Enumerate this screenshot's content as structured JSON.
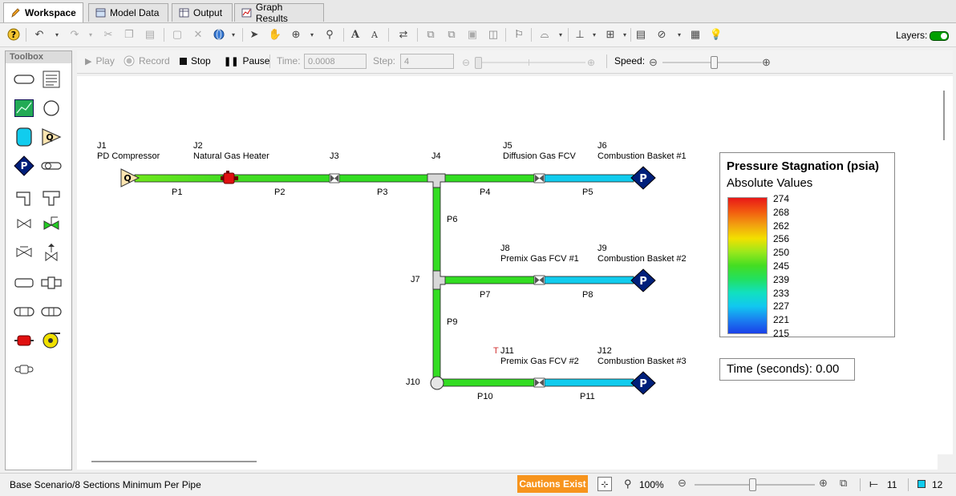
{
  "tabs": [
    {
      "label": "Workspace",
      "icon": "pencil-icon",
      "active": true
    },
    {
      "label": "Model Data",
      "icon": "model-data-icon",
      "active": false
    },
    {
      "label": "Output",
      "icon": "output-table-icon",
      "active": false
    },
    {
      "label": "Graph Results",
      "icon": "graph-icon",
      "active": false
    }
  ],
  "toolbar": {
    "layers_label": "Layers:"
  },
  "toolbox": {
    "title": "Toolbox"
  },
  "transient": {
    "play": "Play",
    "record": "Record",
    "stop": "Stop",
    "pause": "Pause",
    "time_label": "Time:",
    "time_value": "0.0008",
    "step_label": "Step:",
    "step_value": "4",
    "speed_label": "Speed:"
  },
  "junctions": {
    "J1": {
      "id": "J1",
      "name": "PD Compressor"
    },
    "J2": {
      "id": "J2",
      "name": "Natural Gas Heater"
    },
    "J3": {
      "id": "J3"
    },
    "J4": {
      "id": "J4"
    },
    "J5": {
      "id": "J5",
      "name": "Diffusion Gas FCV"
    },
    "J6": {
      "id": "J6",
      "name": "Combustion Basket #1"
    },
    "J7": {
      "id": "J7"
    },
    "J8": {
      "id": "J8",
      "name": "Premix Gas FCV #1"
    },
    "J9": {
      "id": "J9",
      "name": "Combustion Basket #2"
    },
    "J10": {
      "id": "J10"
    },
    "J11": {
      "id": "J11",
      "name": "Premix Gas FCV #2",
      "flag": "T"
    },
    "J12": {
      "id": "J12",
      "name": "Combustion Basket #3"
    }
  },
  "pipes": [
    "P1",
    "P2",
    "P3",
    "P4",
    "P5",
    "P6",
    "P7",
    "P8",
    "P9",
    "P10",
    "P11"
  ],
  "node_glyphs": {
    "compressor": "Q",
    "pressure": "P"
  },
  "legend": {
    "title": "Pressure Stagnation (psia)",
    "subtitle": "Absolute Values",
    "ticks": [
      "274",
      "268",
      "262",
      "256",
      "250",
      "245",
      "239",
      "233",
      "227",
      "221",
      "215"
    ]
  },
  "time_display": "Time (seconds): 0.00",
  "status": {
    "scenario": "Base Scenario/8 Sections Minimum Per Pipe",
    "cautions": "Cautions Exist",
    "zoom": "100%",
    "pipe_count": "11",
    "junction_count": "12"
  },
  "colors": {
    "pipe_green": "#33dd22",
    "pipe_light_green": "#55ee22",
    "pipe_cyan": "#11ccee",
    "caution_orange": "#f7941d",
    "node_navy": "#001f7a",
    "compressor_fill": "#fde5b0"
  }
}
